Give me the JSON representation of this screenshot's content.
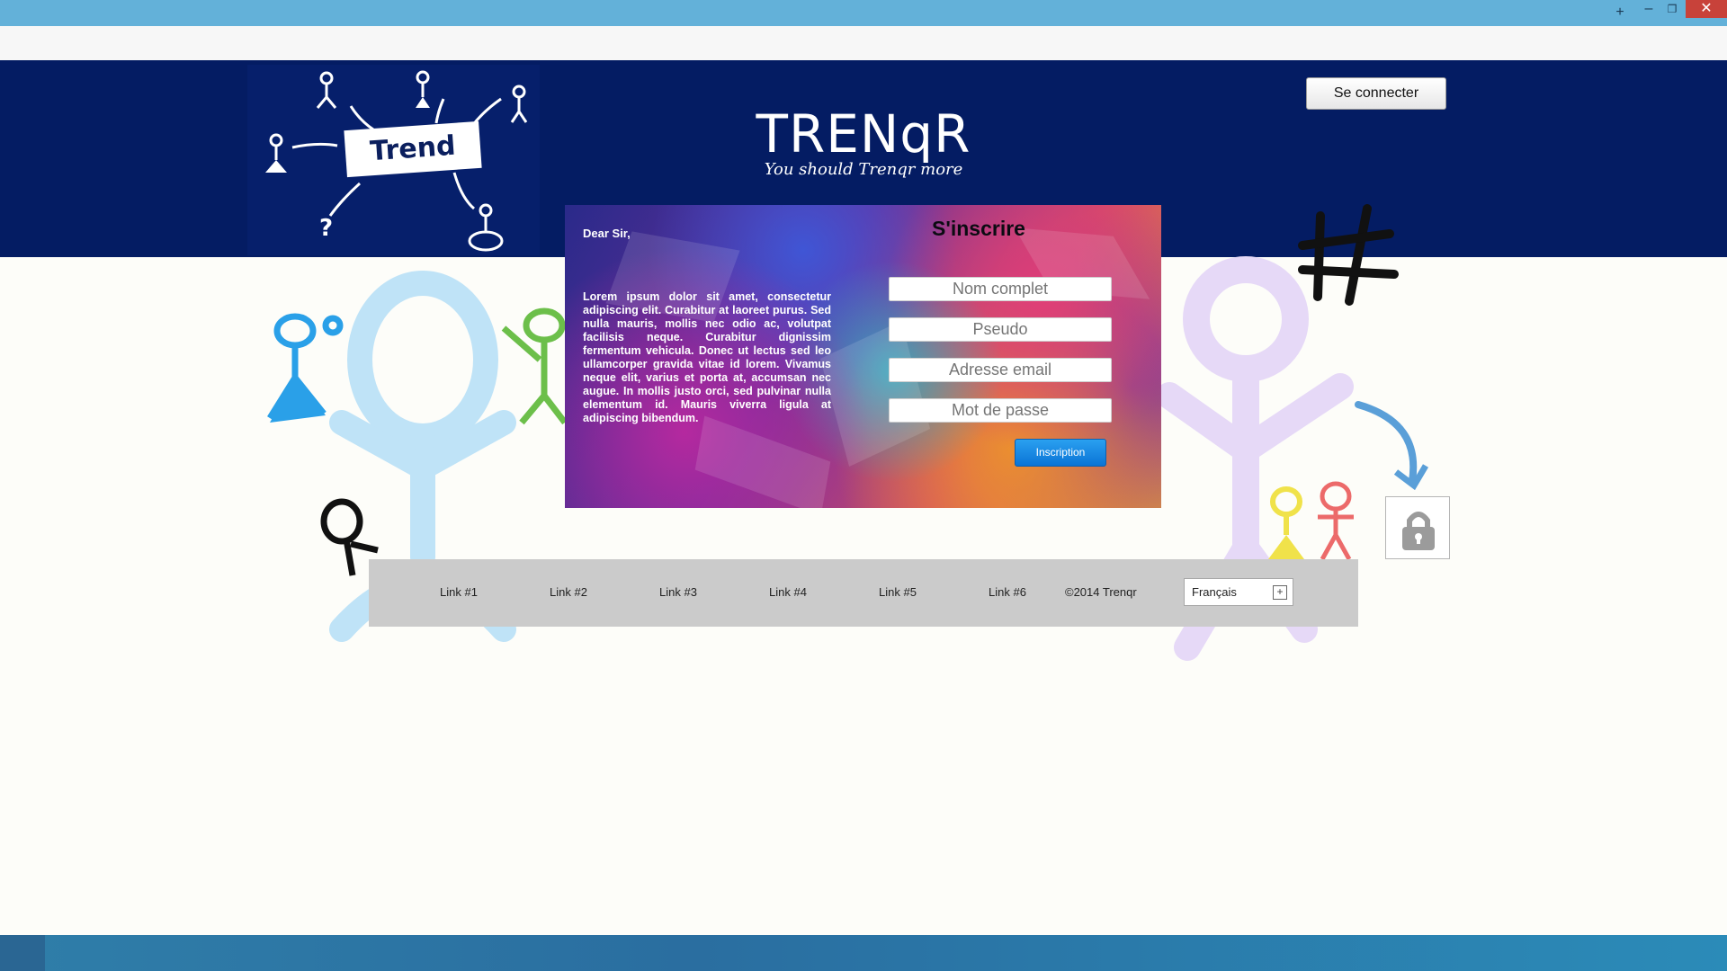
{
  "window": {
    "controls": {
      "new_tab": "+",
      "minimize": "–",
      "maximize": "❐",
      "close": "✕"
    }
  },
  "header": {
    "logo_text": "Trend",
    "title": "TRENqR",
    "tagline": "You should Trenqr more",
    "login_button": "Se connecter"
  },
  "panel": {
    "greeting": "Dear Sir,",
    "body": "Lorem ipsum dolor sit amet, consectetur adipiscing elit. Curabitur at laoreet purus. Sed nulla mauris, mollis nec odio ac, volutpat facilisis neque. Curabitur dignissim fermentum vehicula. Donec ut lectus sed leo ullamcorper gravida vitae id lorem. Vivamus neque elit, varius et porta at, accumsan nec augue. In mollis justo orci, sed pulvinar nulla elementum id. Mauris viverra ligula at adipiscing bibendum.",
    "signup": {
      "title": "S'inscrire",
      "fields": {
        "fullname_placeholder": "Nom complet",
        "username_placeholder": "Pseudo",
        "email_placeholder": "Adresse email",
        "password_placeholder": "Mot de passe"
      },
      "submit": "Inscription"
    }
  },
  "footer": {
    "links": [
      "Link #1",
      "Link #2",
      "Link #3",
      "Link #4",
      "Link #5",
      "Link #6"
    ],
    "copyright": "©2014 Trenqr",
    "language": "Français"
  },
  "icons": {
    "lock": "lock-icon",
    "plus": "plus-icon"
  },
  "colors": {
    "header_bg": "#041c63",
    "titlebar": "#63b1d9",
    "accent_button": "#0a74d6",
    "footer_bg": "#cbcbcb"
  }
}
